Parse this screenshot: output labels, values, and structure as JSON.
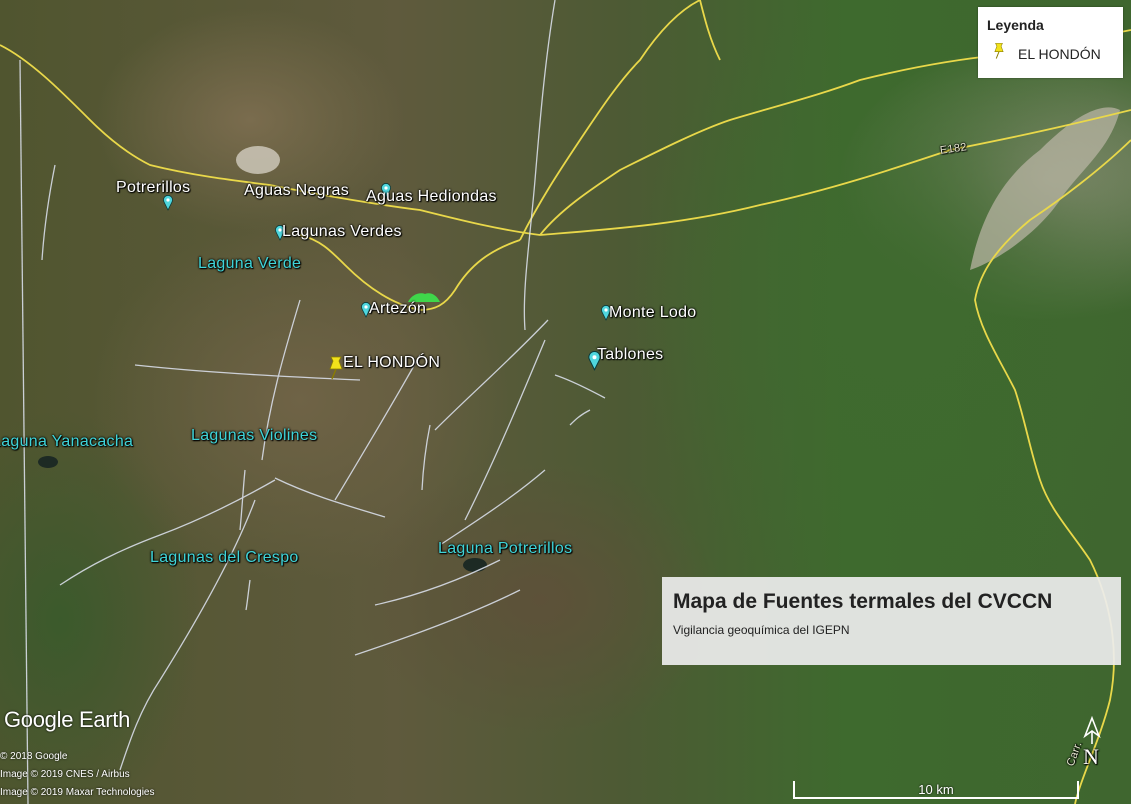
{
  "legend": {
    "title": "Leyenda",
    "item_label": "EL HONDÓN",
    "item_icon": "yellow-pushpin-icon"
  },
  "places": {
    "potrerillos": "Potrerillos",
    "aguas_negras": "Aguas Negras",
    "aguas_hediondas": "Aguas Hediondas",
    "lagunas_verdes": "Lagunas Verdes",
    "laguna_verde": "Laguna Verde",
    "artezon": "Artezón",
    "monte_lodo": "Monte Lodo",
    "tablones": "Tablones",
    "el_hondon": "EL HONDÓN",
    "laguna_yanacacha": "Laguna Yanacacha",
    "lagunas_violines": "Lagunas Violines",
    "lagunas_del_crespo": "Lagunas del Crespo",
    "laguna_potrerillos": "Laguna Potrerillos"
  },
  "road_labels": {
    "e182": "E182",
    "carr": "Carr."
  },
  "title_box": {
    "title": "Mapa de Fuentes termales del CVCCN",
    "subtitle": "Vigilancia geoquímica del IGEPN"
  },
  "branding": "Google Earth",
  "credits": {
    "c1": "© 2018 Google",
    "c2": "Image © 2019 CNES / Airbus",
    "c3": "Image © 2019 Maxar Technologies"
  },
  "scale": {
    "label": "10 km"
  },
  "compass": {
    "label": "N"
  },
  "colors": {
    "road": "#e9d84a",
    "fault_line": "#d8dde8",
    "place_white": "#ffffff",
    "place_cyan": "#3fd4d8",
    "hot_spring_pin": "#4fd6dd",
    "el_hondon_pin": "#f2e21b"
  }
}
